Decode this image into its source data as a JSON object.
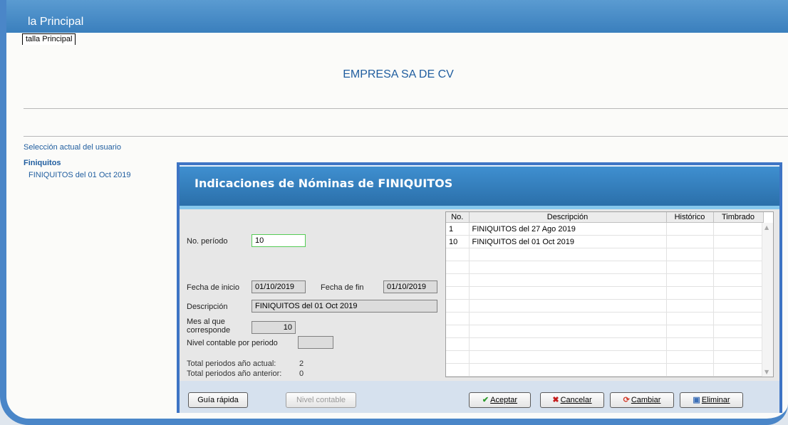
{
  "window": {
    "title": "la Principal",
    "tab_label": "talla Principal"
  },
  "company_name": "EMPRESA SA DE CV",
  "user_selection": {
    "label": "Selección actual del usuario",
    "group": "Finiquitos",
    "item": "FINIQUITOS del 01 Oct 2019"
  },
  "dialog": {
    "title": "Indicaciones de Nóminas de FINIQUITOS",
    "periodo_label": "No. período",
    "periodo_value": "10",
    "fecha_inicio_label": "Fecha de inicio",
    "fecha_inicio_value": "01/10/2019",
    "fecha_fin_label": "Fecha de fin",
    "fecha_fin_value": "01/10/2019",
    "descripcion_label": "Descripción",
    "descripcion_value": "FINIQUITOS del 01 Oct 2019",
    "mes_label_1": "Mes al que",
    "mes_label_2": "corresponde",
    "mes_value": "10",
    "nivel_label": "Nivel contable por periodo",
    "nivel_value": "",
    "total_actual_label": "Total periodos año actual:",
    "total_actual_value": "2",
    "total_anterior_label": "Total periodos año anterior:",
    "total_anterior_value": "0",
    "grid": {
      "headers": [
        "No.",
        "Descripción",
        "Histórico",
        "Timbrado"
      ],
      "rows": [
        {
          "no": "1",
          "descripcion": "FINIQUITOS del 27 Ago 2019",
          "historico": "",
          "timbrado": ""
        },
        {
          "no": "10",
          "descripcion": "FINIQUITOS del 01 Oct 2019",
          "historico": "",
          "timbrado": ""
        }
      ]
    },
    "buttons": {
      "guia": "Guía rápida",
      "nivel": "Nivel contable",
      "aceptar": "Aceptar",
      "cancelar": "Cancelar",
      "cambiar": "Cambiar",
      "eliminar": "Eliminar"
    }
  },
  "colors": {
    "accent": "#3e74c4",
    "header": "#2a6ea8",
    "link_text": "#1f5d9f"
  }
}
